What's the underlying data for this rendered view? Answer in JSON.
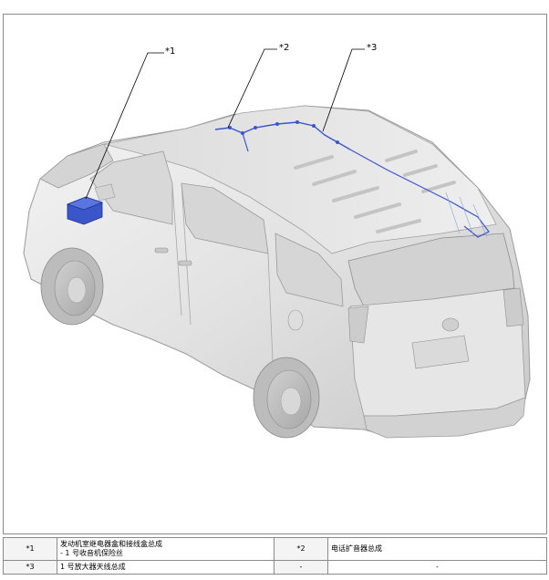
{
  "callouts": {
    "c1": "*1",
    "c2": "*2",
    "c3": "*3"
  },
  "legend": {
    "rows": [
      {
        "code": "*1",
        "desc_line1": "发动机室继电器盒和接线盒总成",
        "desc_line2": "- 1 号收音机保险丝",
        "code2": "*2",
        "desc2": "电话扩音器总成"
      },
      {
        "code": "*3",
        "desc": "1 号放大器天线总成",
        "code2": "-",
        "desc2": "-"
      }
    ]
  },
  "colors": {
    "component_highlight": "#3a56c8",
    "vehicle_body": "#e4e4e4",
    "border": "#8a8a8a"
  }
}
